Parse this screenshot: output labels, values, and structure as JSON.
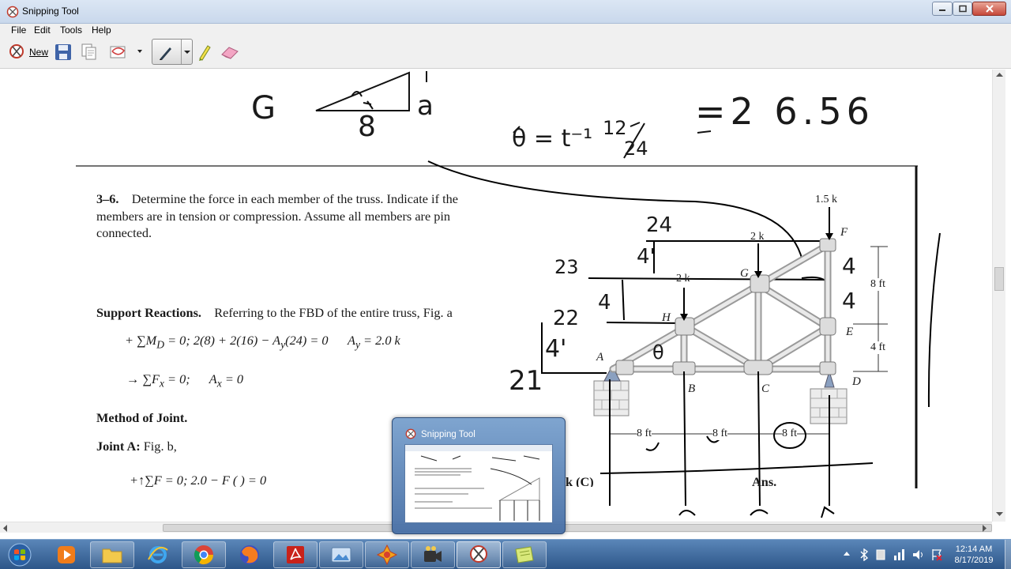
{
  "window": {
    "title": "Snipping Tool"
  },
  "menu": [
    "File",
    "Edit",
    "Tools",
    "Help"
  ],
  "toolbar": {
    "new_label": "New",
    "icons": [
      "new-snip-icon",
      "save-icon",
      "copy-icon",
      "send-snip-icon",
      "pen-icon",
      "highlighter-icon",
      "eraser-icon"
    ]
  },
  "snip": {
    "top_notes": {
      "g": "G",
      "eight": "8",
      "a": "a",
      "theta_eq": "θ = t⁻¹",
      "frac_num": "12",
      "frac_den": "24",
      "result": "=2  6.56"
    },
    "problem": {
      "number": "3–6.",
      "text": "Determine the force in each member of the truss. Indicate if the members are in tension or compression. Assume all members are pin connected."
    },
    "support": {
      "heading": "Support Reactions.",
      "intro": "Referring to the FBD of the entire truss, Fig. a",
      "eq1_lhs": "+ ∑M",
      "eq1_sub": "D",
      "eq1_rhs": "= 0;     2(8) + 2(16) − A",
      "eq1_sub2": "y",
      "eq1_end": "(24) = 0",
      "eq1_ans": "A",
      "eq1_ans_sub": "y",
      "eq1_ans_val": "= 2.0 k",
      "eq2_lhs": "∑F",
      "eq2_sub": "x",
      "eq2_rhs": "= 0;",
      "eq2_ans": "A",
      "eq2_ans_sub": "x",
      "eq2_ans_val": "= 0"
    },
    "method": "Method of Joint.",
    "joint_a": {
      "label": "Joint A:",
      "fig": "Fig. b,",
      "partial": "+↑∑F   = 0;    2.0 − F      (    )  = 0"
    },
    "ans_tail": "k (C)",
    "ans": "Ans.",
    "truss_labels": {
      "load_f": "1.5  k",
      "load_g": "2  k",
      "load_h": "2  k",
      "A": "A",
      "B": "B",
      "C": "C",
      "D": "D",
      "E": "E",
      "F": "F",
      "G": "G",
      "H": "H",
      "dim_8ft": "8 ft",
      "dim_4ft": "4 ft",
      "span1": "8 ft",
      "span2": "8 ft",
      "span3": "8 ft"
    },
    "handwriting": {
      "h24": "24",
      "h4a": "4'",
      "h23": "23",
      "h4b": "4",
      "h22": "22",
      "h4c": "4'",
      "h21": "21",
      "theta": "θ",
      "r4a": "4",
      "r4b": "4"
    }
  },
  "thumbnail": {
    "title": "Snipping Tool"
  },
  "taskbar": {
    "apps": [
      "start-orb",
      "media-player",
      "file-explorer",
      "internet-explorer",
      "chrome",
      "firefox",
      "acrobat",
      "photo-viewer",
      "puzzle-app",
      "video-app",
      "snipping-tool",
      "notes-app"
    ],
    "time": "12:14 AM",
    "date": "8/17/2019"
  }
}
